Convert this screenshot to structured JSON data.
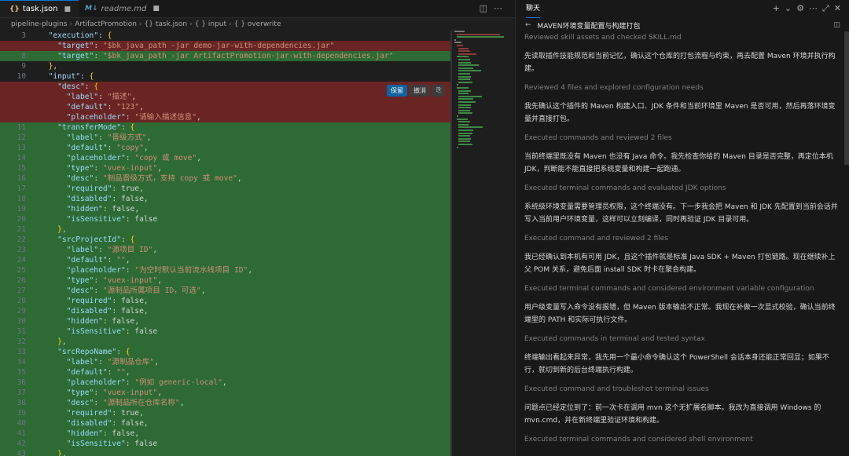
{
  "editor": {
    "tabs": [
      {
        "icon": "{}",
        "label": "task.json"
      },
      {
        "icon": "M↓",
        "label": "readme.md"
      }
    ],
    "breadcrumbs": [
      "pipeline-plugins",
      "ArtifactPromotion",
      "{} task.json",
      "{ } input",
      "{ } overwrite"
    ],
    "hunk_actions": {
      "keep": "保留",
      "undo": "撤消"
    },
    "lines": [
      {
        "n": "3",
        "t": "  \"execution\": {",
        "kind": ""
      },
      {
        "n": "",
        "t": "    \"target\": \"$bk_java_path -jar demo-jar-with-dependencies.jar\"",
        "kind": "del"
      },
      {
        "n": "8",
        "t": "    \"target\": \"$bk_java_path -jar ArtifactPromotion-jar-with-dependencies.jar\"",
        "kind": "add"
      },
      {
        "n": "9",
        "t": "  },",
        "kind": ""
      },
      {
        "n": "10",
        "t": "  \"input\": {",
        "kind": ""
      },
      {
        "n": "",
        "t": "    \"desc\": {",
        "kind": "del"
      },
      {
        "n": "",
        "t": "      \"label\": \"描述\",",
        "kind": "del"
      },
      {
        "n": "",
        "t": "      \"default\": \"123\",",
        "kind": "del"
      },
      {
        "n": "",
        "t": "      \"placeholder\": \"请输入描述信息\",",
        "kind": "del"
      },
      {
        "n": "11",
        "t": "    \"transferMode\": {",
        "kind": "add"
      },
      {
        "n": "12",
        "t": "      \"label\": \"晋级方式\",",
        "kind": "add"
      },
      {
        "n": "13",
        "t": "      \"default\": \"copy\",",
        "kind": "add"
      },
      {
        "n": "14",
        "t": "      \"placeholder\": \"copy 或 move\",",
        "kind": "add"
      },
      {
        "n": "15",
        "t": "      \"type\": \"vuex-input\",",
        "kind": "add"
      },
      {
        "n": "16",
        "t": "      \"desc\": \"制品晋级方式，支持 copy 或 move\",",
        "kind": "add"
      },
      {
        "n": "17",
        "t": "      \"required\": true,",
        "kind": "add"
      },
      {
        "n": "18",
        "t": "      \"disabled\": false,",
        "kind": "add"
      },
      {
        "n": "19",
        "t": "      \"hidden\": false,",
        "kind": "add"
      },
      {
        "n": "20",
        "t": "      \"isSensitive\": false",
        "kind": "add"
      },
      {
        "n": "21",
        "t": "    },",
        "kind": "add"
      },
      {
        "n": "22",
        "t": "    \"srcProjectId\": {",
        "kind": "add"
      },
      {
        "n": "23",
        "t": "      \"label\": \"源项目 ID\",",
        "kind": "add"
      },
      {
        "n": "24",
        "t": "      \"default\": \"\",",
        "kind": "add"
      },
      {
        "n": "25",
        "t": "      \"placeholder\": \"为空时默认当前流水线项目 ID\",",
        "kind": "add"
      },
      {
        "n": "26",
        "t": "      \"type\": \"vuex-input\",",
        "kind": "add"
      },
      {
        "n": "27",
        "t": "      \"desc\": \"源制品所属项目 ID，可选\",",
        "kind": "add"
      },
      {
        "n": "28",
        "t": "      \"required\": false,",
        "kind": "add"
      },
      {
        "n": "29",
        "t": "      \"disabled\": false,",
        "kind": "add"
      },
      {
        "n": "30",
        "t": "      \"hidden\": false,",
        "kind": "add"
      },
      {
        "n": "31",
        "t": "      \"isSensitive\": false",
        "kind": "add"
      },
      {
        "n": "32",
        "t": "    },",
        "kind": "add"
      },
      {
        "n": "33",
        "t": "    \"srcRepoName\": {",
        "kind": "add"
      },
      {
        "n": "34",
        "t": "      \"label\": \"源制品仓库\",",
        "kind": "add"
      },
      {
        "n": "35",
        "t": "      \"default\": \"\",",
        "kind": "add"
      },
      {
        "n": "36",
        "t": "      \"placeholder\": \"例如 generic-local\",",
        "kind": "add"
      },
      {
        "n": "37",
        "t": "      \"type\": \"vuex-input\",",
        "kind": "add"
      },
      {
        "n": "38",
        "t": "      \"desc\": \"源制品所在仓库名称\",",
        "kind": "add"
      },
      {
        "n": "39",
        "t": "      \"required\": true,",
        "kind": "add"
      },
      {
        "n": "40",
        "t": "      \"disabled\": false,",
        "kind": "add"
      },
      {
        "n": "41",
        "t": "      \"hidden\": false,",
        "kind": "add"
      },
      {
        "n": "42",
        "t": "      \"isSensitive\": false",
        "kind": "add"
      },
      {
        "n": "43",
        "t": "    },",
        "kind": "add"
      }
    ]
  },
  "chat": {
    "tab": "聊天",
    "title": "MAVEN环境变量配置与构建打包",
    "entries": [
      {
        "type": "meta",
        "text": "Reviewed skill assets and checked SKILL.md"
      },
      {
        "type": "msg",
        "text": "先读取插件技能规范和当前记忆，确认这个仓库的打包流程与约束，再去配置 Maven 环境并执行构建。"
      },
      {
        "type": "meta",
        "text": "Reviewed 4 files and explored configuration needs"
      },
      {
        "type": "msg",
        "text": "我先确认这个插件的 Maven 构建入口、JDK 条件和当前环境里 Maven 是否可用，然后再落环境变量并直接打包。"
      },
      {
        "type": "meta",
        "text": "Executed commands and reviewed 2 files"
      },
      {
        "type": "msg",
        "text": "当前终端里既没有 Maven 也没有 Java 命令。我先检查你给的 Maven 目录是否完整，再定位本机 JDK，判断能不能直接把系统变量和构建一起跑通。"
      },
      {
        "type": "meta",
        "text": "Executed terminal commands and evaluated JDK options"
      },
      {
        "type": "msg",
        "text": "系统级环境变量需要管理员权限，这个终端没有。下一步我会把 Maven 和 JDK 先配置到当前会话并写入当前用户环境变量，这样可以立刻编译，同时再验证 JDK 目录可用。"
      },
      {
        "type": "meta",
        "text": "Executed command and reviewed 2 files"
      },
      {
        "type": "msg",
        "text": "我已经确认到本机有可用 JDK，且这个插件就是标准 Java SDK + Maven 打包链路。现在继续补上父 POM 关系，避免后面 install SDK 时卡在聚合构建。"
      },
      {
        "type": "meta",
        "text": "Executed terminal commands and considered environment variable configuration"
      },
      {
        "type": "msg",
        "text": "用户级变量写入命令没有报错，但 Maven 版本输出不正常。我现在补做一次显式校验，确认当前终端里的 PATH 和实际可执行文件。"
      },
      {
        "type": "meta",
        "text": "Executed commands in terminal and tested syntax"
      },
      {
        "type": "msg",
        "text": "终端输出看起来异常，我先用一个最小命令确认这个 PowerShell 会话本身还能正常回显；如果不行，就切到新的后台终端执行构建。"
      },
      {
        "type": "meta",
        "text": "Executed command and troubleshot terminal issues"
      },
      {
        "type": "msg",
        "text": "问题点已经定位到了：前一次卡在调用 mvn 这个无扩展名脚本。我改为直接调用 Windows 的 mvn.cmd，并在新终端里验证环境和构建。"
      },
      {
        "type": "meta",
        "text": "Executed terminal commands and considered shell environment"
      }
    ]
  }
}
